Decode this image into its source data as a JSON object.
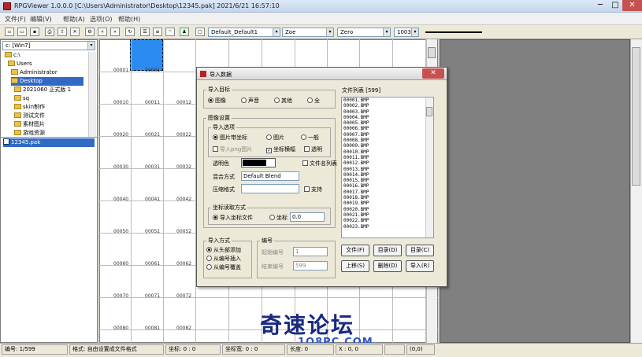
{
  "window": {
    "title": "RPGViewer 1.0.0.0 [C:\\Users\\Administrator\\Desktop\\12345.pak] 2021/6/21 16:57:10"
  },
  "menu": [
    "文件(F)",
    "编辑(V)",
    "帮助(A)",
    "选项(O)",
    "帮助(H)"
  ],
  "toolbar": {
    "dd1": "Default_Default1",
    "dd2": "Zoe",
    "dd3": "Zero",
    "dd4": "1003"
  },
  "tree": {
    "drive": "c: [Win7]",
    "items": [
      "c:\\",
      "Users",
      "Administrator",
      "Desktop",
      "2021060 正式版 1",
      "sq",
      "skin制作",
      "测试文件",
      "素材图片",
      "游戏资源"
    ],
    "file": "12345.pak"
  },
  "grid": {
    "rows": [
      [
        "00001",
        "00001",
        ""
      ],
      [
        "00010",
        "00011",
        "00012"
      ],
      [
        "00020",
        "00021",
        "00022"
      ],
      [
        "00030",
        "00031",
        "00032"
      ],
      [
        "00040",
        "00041",
        "00042"
      ],
      [
        "00050",
        "00051",
        "00052"
      ],
      [
        "00060",
        "00061",
        "00062"
      ],
      [
        "00070",
        "00071",
        "00072"
      ],
      [
        "00080",
        "00081",
        "00082"
      ]
    ]
  },
  "dialog": {
    "title": "导入数据",
    "target_label": "导入目标",
    "targets": [
      "图像",
      "声音",
      "其他",
      "全"
    ],
    "image_settings_label": "图像设置",
    "import_options_label": "导入选项",
    "opt_a": "图片带坐标",
    "opt_b": "图片",
    "opt_c": "一般",
    "chk_a": "导入png图片",
    "chk_b": "坐标横幅",
    "chk_c": "透明",
    "transparent_label": "透明色",
    "blend_label": "混合方式",
    "blend_value": "Default Blend",
    "compress_label": "压缩格式",
    "compress_chk": "支持",
    "dir_label": "文件名列表",
    "coord_label": "坐标读取方式",
    "coord_a": "导入坐标文件",
    "coord_b": "坐标",
    "coord_value": "0.0",
    "mode_label": "导入方式",
    "modes": [
      "从头部添加",
      "从编号插入",
      "从编号覆盖"
    ],
    "num_label": "编号",
    "start_label": "起始编号",
    "start_value": "1",
    "end_label": "结束编号",
    "end_value": "599",
    "list_label": "文件列表 [599]",
    "files": [
      "00001.BMP",
      "00002.BMP",
      "00003.BMP",
      "00004.BMP",
      "00005.BMP",
      "00006.BMP",
      "00007.BMP",
      "00008.BMP",
      "00009.BMP",
      "00010.BMP",
      "00011.BMP",
      "00012.BMP",
      "00013.BMP",
      "00014.BMP",
      "00015.BMP",
      "00016.BMP",
      "00017.BMP",
      "00018.BMP",
      "00019.BMP",
      "00020.BMP",
      "00021.BMP",
      "00022.BMP",
      "00023.BMP"
    ],
    "buttons": [
      "文件(F)",
      "目录(D)",
      "目录(C)",
      "上移(S)",
      "删除(D)",
      "导入(R)"
    ]
  },
  "status": [
    "编号: 1/599",
    "格式: 自由设置成文件格式",
    "坐标: 0 : 0",
    "坐标宽: 0 : 0",
    "长度: 0",
    "X : 0, 0",
    "",
    "(0,0)"
  ],
  "watermark": {
    "line1": "奇速论坛",
    "line2": "1O8PC.COM"
  }
}
